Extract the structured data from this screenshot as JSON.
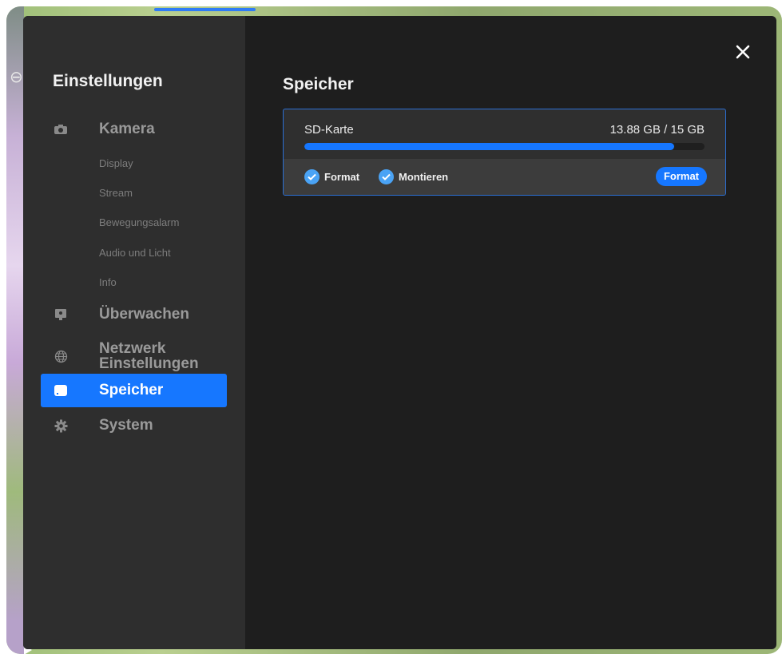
{
  "sidebar": {
    "title": "Einstellungen",
    "items": [
      {
        "label": "Kamera",
        "icon": "camera-icon"
      },
      {
        "label": "Überwachen",
        "icon": "monitor-icon"
      },
      {
        "label": "Netzwerk\nEinstellungen",
        "icon": "globe-icon"
      },
      {
        "label": "Speicher",
        "icon": "storage-icon",
        "active": true
      },
      {
        "label": "System",
        "icon": "gear-icon"
      }
    ],
    "sub_items": [
      "Display",
      "Stream",
      "Bewegungsalarm",
      "Audio und Licht",
      "Info"
    ]
  },
  "content": {
    "title": "Speicher",
    "card": {
      "name": "SD-Karte",
      "size": "13.88 GB / 15 GB",
      "usage_fraction": 0.925,
      "checks": [
        "Format",
        "Montieren"
      ],
      "button": "Format"
    }
  },
  "colors": {
    "accent": "#1677ff",
    "modal_bg": "#1e1e1e",
    "sidebar_bg": "#2e2e2e",
    "check": "#4aa3f5"
  }
}
